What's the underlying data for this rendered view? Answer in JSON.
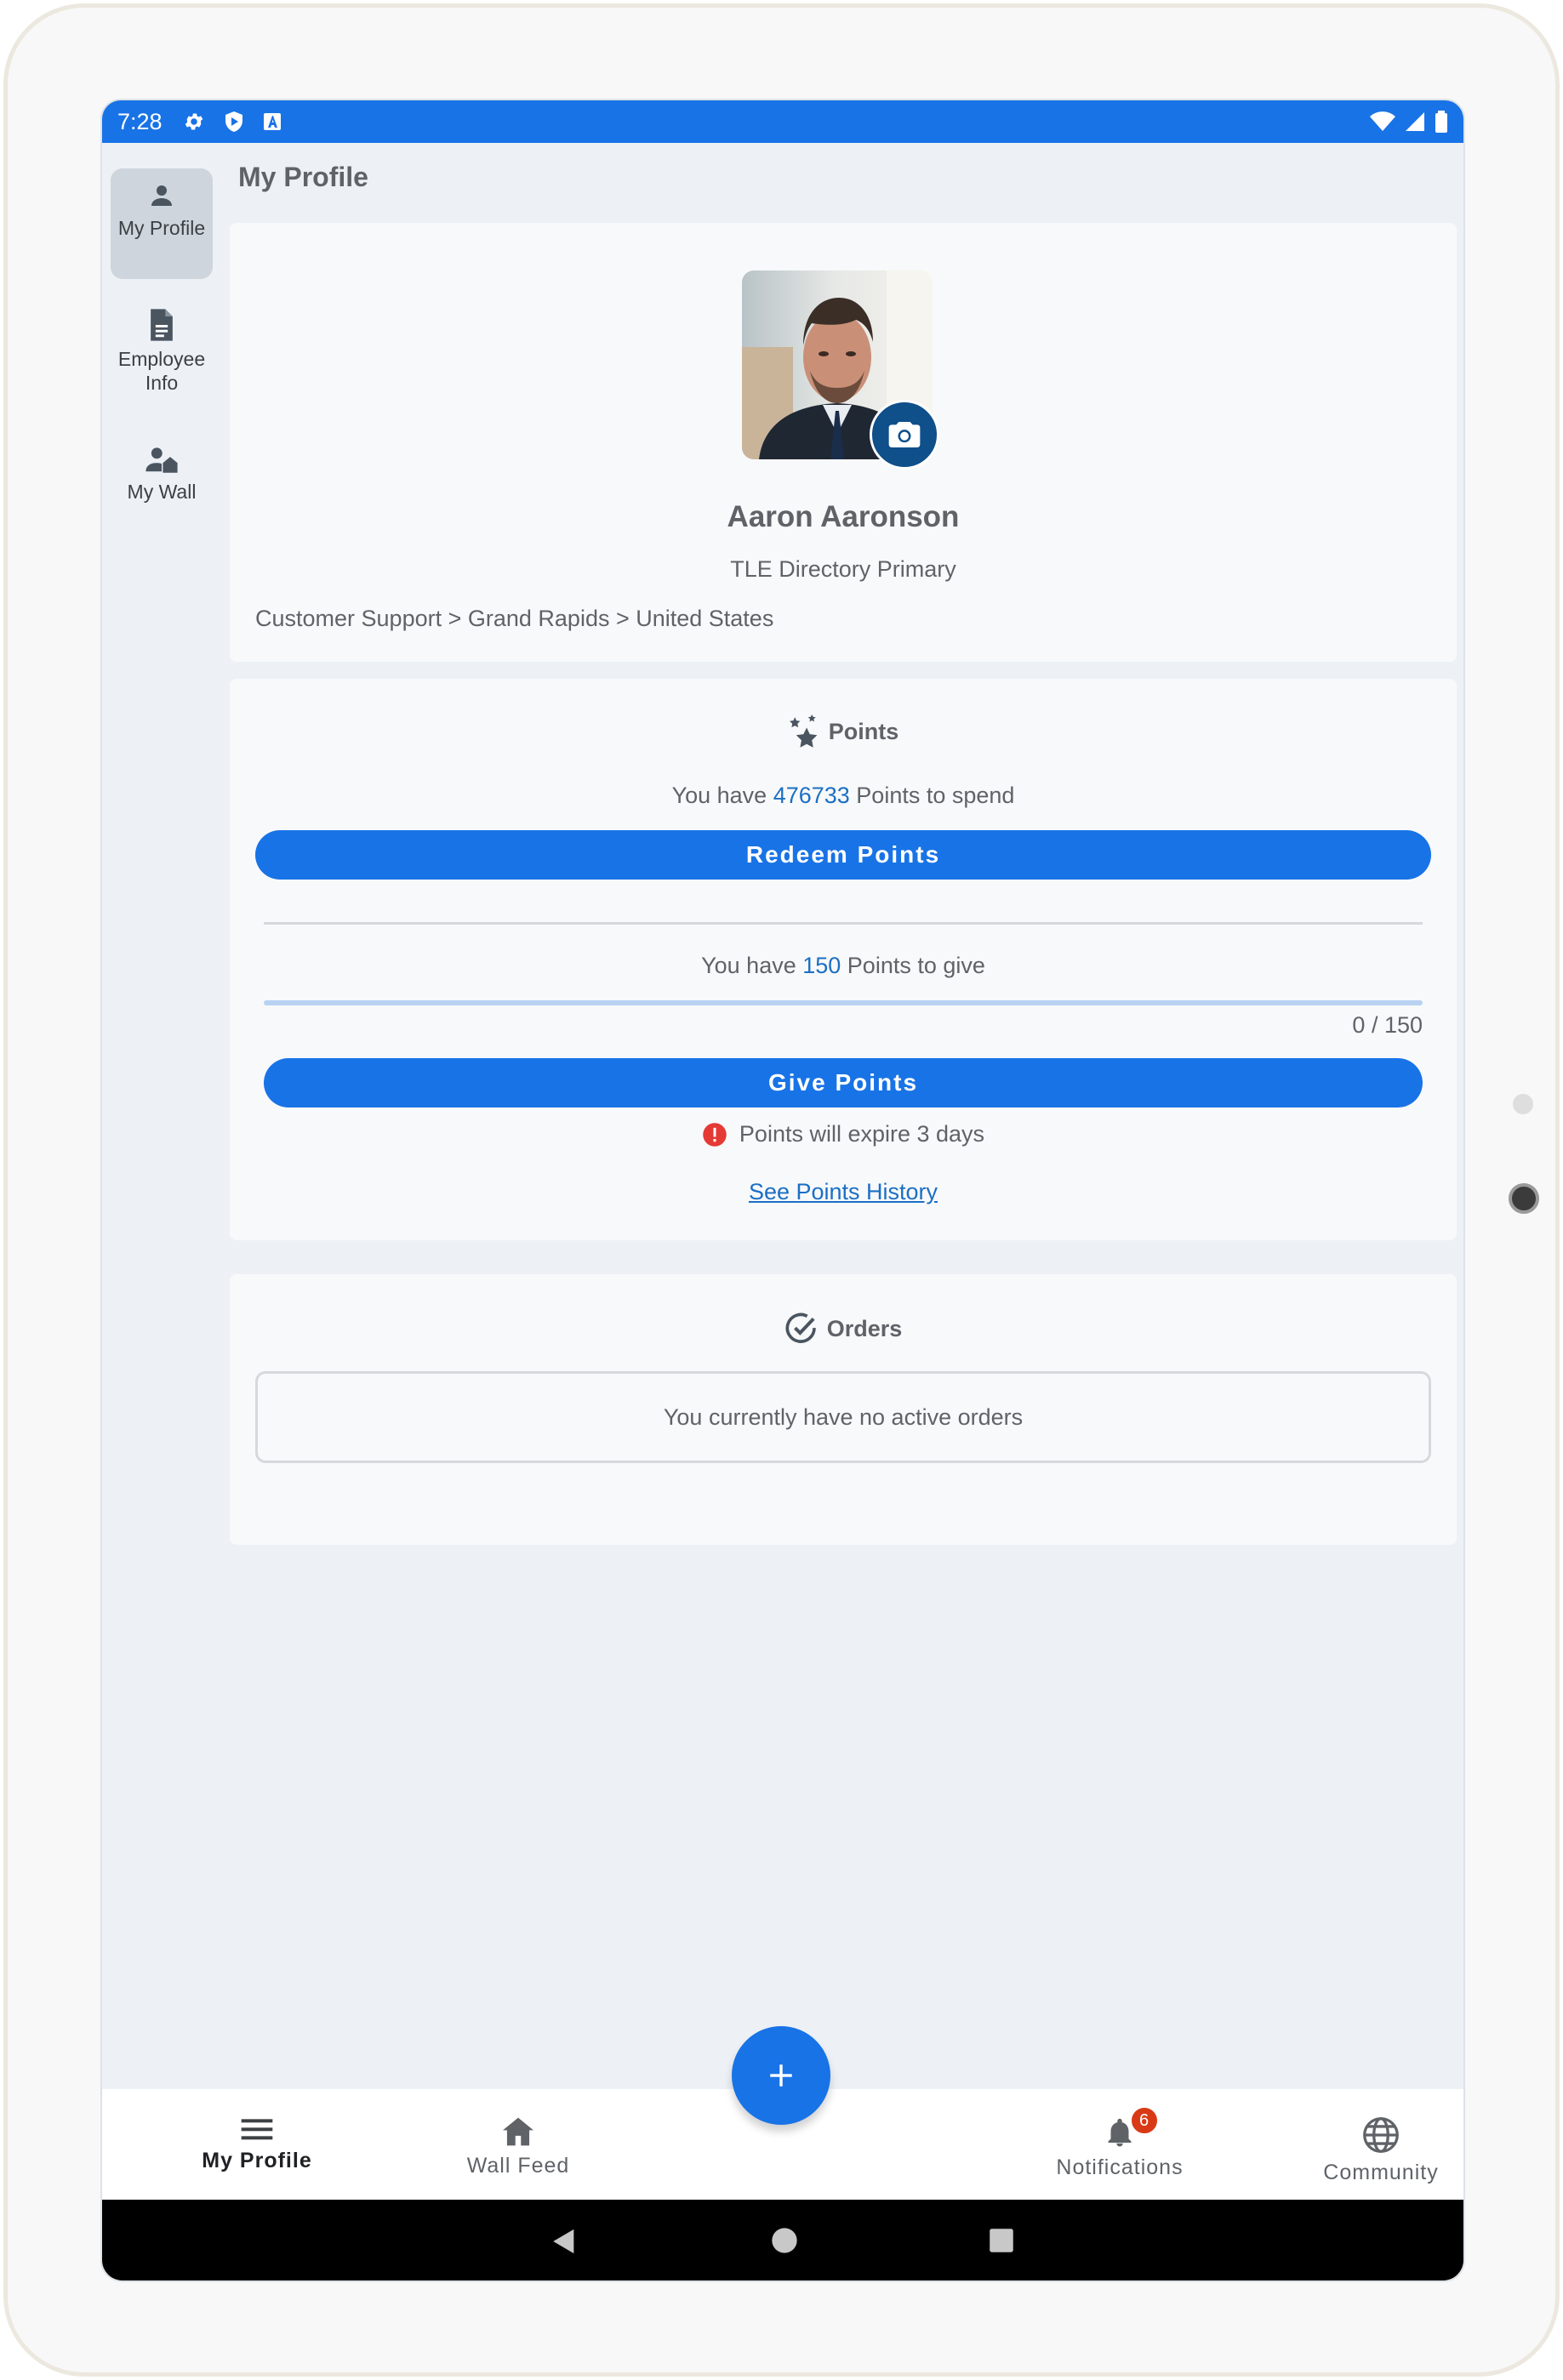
{
  "status_bar": {
    "time": "7:28"
  },
  "page_title": "My Profile",
  "rail": {
    "items": [
      {
        "label": "My Profile",
        "icon": "person-icon",
        "active": true
      },
      {
        "label_line1": "Employee",
        "label_line2": "Info",
        "icon": "document-icon",
        "active": false
      },
      {
        "label": "My Wall",
        "icon": "person-wall-icon",
        "active": false
      }
    ]
  },
  "profile": {
    "name": "Aaron Aaronson",
    "subtitle": "TLE Directory Primary",
    "path": "Customer Support > Grand Rapids > United States"
  },
  "points": {
    "title": "Points",
    "spend_prefix": "You have ",
    "spend_value": "476733",
    "spend_suffix": " Points to spend",
    "redeem_label": "Redeem Points",
    "give_prefix": "You have ",
    "give_value": "150",
    "give_suffix": " Points to give",
    "progress_label": "0 / 150",
    "progress_fraction": 0,
    "give_label": "Give Points",
    "expire_text": "Points will expire 3 days",
    "history_link": "See Points History"
  },
  "orders": {
    "title": "Orders",
    "empty_text": "You currently have no active orders"
  },
  "bottom_nav": {
    "items": [
      {
        "label": "My Profile",
        "icon": "menu-icon",
        "active": true
      },
      {
        "label": "Wall Feed",
        "icon": "home-icon",
        "active": false
      },
      {
        "label": "Notifications",
        "icon": "bell-icon",
        "badge": "6",
        "active": false
      },
      {
        "label": "Community",
        "icon": "globe-icon",
        "active": false
      }
    ]
  },
  "colors": {
    "accent": "#1873e6",
    "badge": "#d93a15",
    "alert": "#e53935",
    "background": "#edf1f6"
  }
}
